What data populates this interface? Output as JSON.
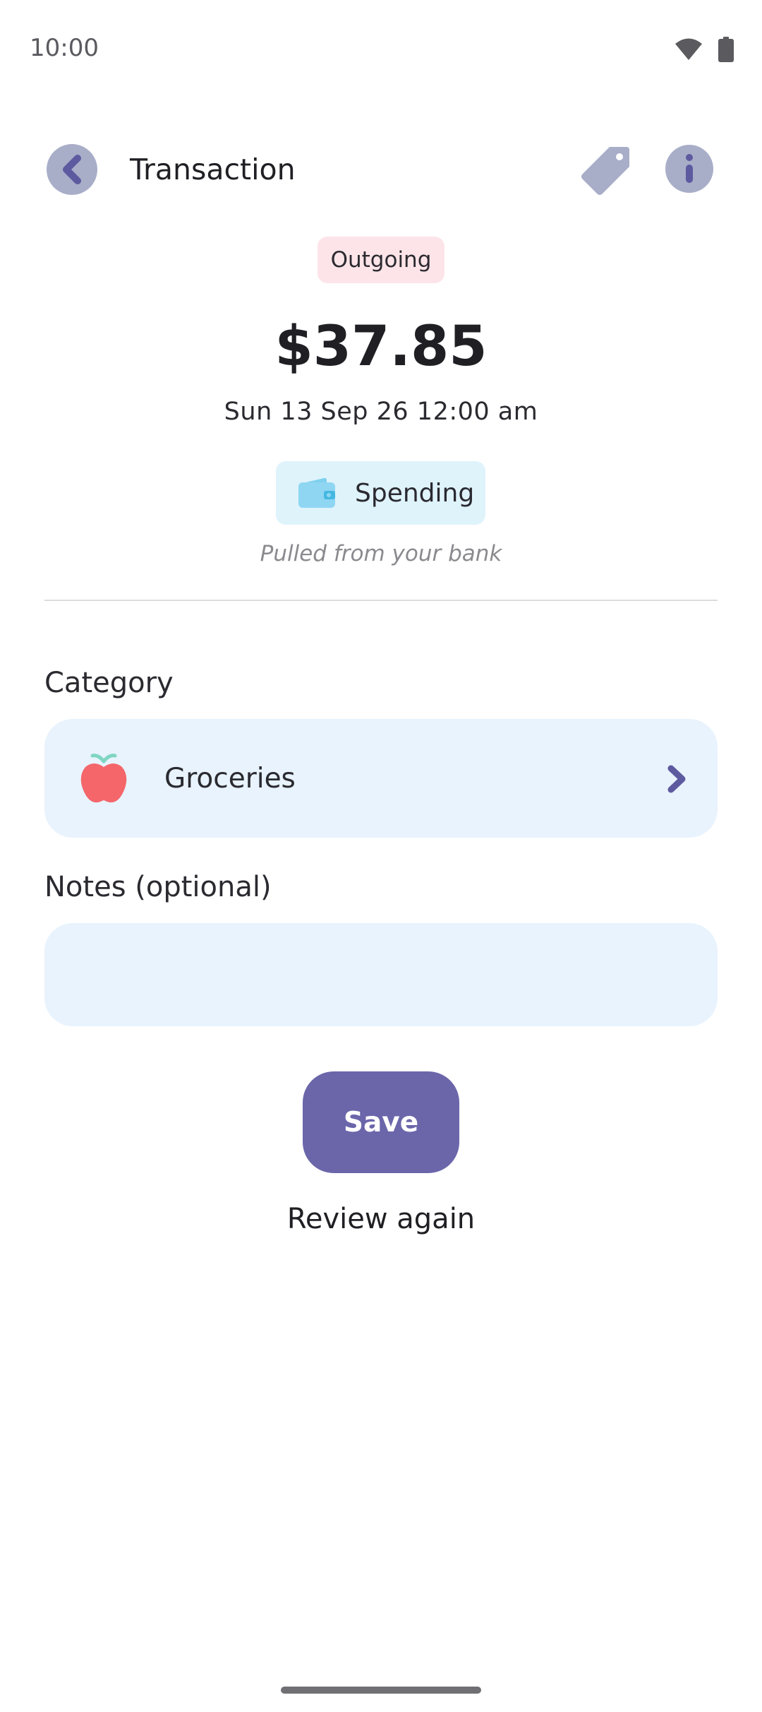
{
  "status_bar": {
    "time": "10:00"
  },
  "header": {
    "title": "Transaction"
  },
  "transaction": {
    "direction": "Outgoing",
    "amount": "$37.85",
    "date": "Sun 13 Sep 26 12:00 am",
    "account": "Spending",
    "source_note": "Pulled from your bank"
  },
  "category": {
    "label": "Category",
    "value": "Groceries"
  },
  "notes": {
    "label": "Notes (optional)",
    "value": "",
    "placeholder": ""
  },
  "actions": {
    "save_label": "Save",
    "review_label": "Review again"
  },
  "colors": {
    "accent": "#6b66aa",
    "icon_bg": "#a8aec8",
    "outgoing_badge": "#fde4e8",
    "account_chip": "#dff3fb",
    "field_bg": "#e8f3fd"
  },
  "icons": {
    "back": "chevron-left-icon",
    "tag": "tag-icon",
    "info": "info-icon",
    "account": "wallet-icon",
    "category": "apple-icon",
    "category_arrow": "chevron-right-icon"
  }
}
